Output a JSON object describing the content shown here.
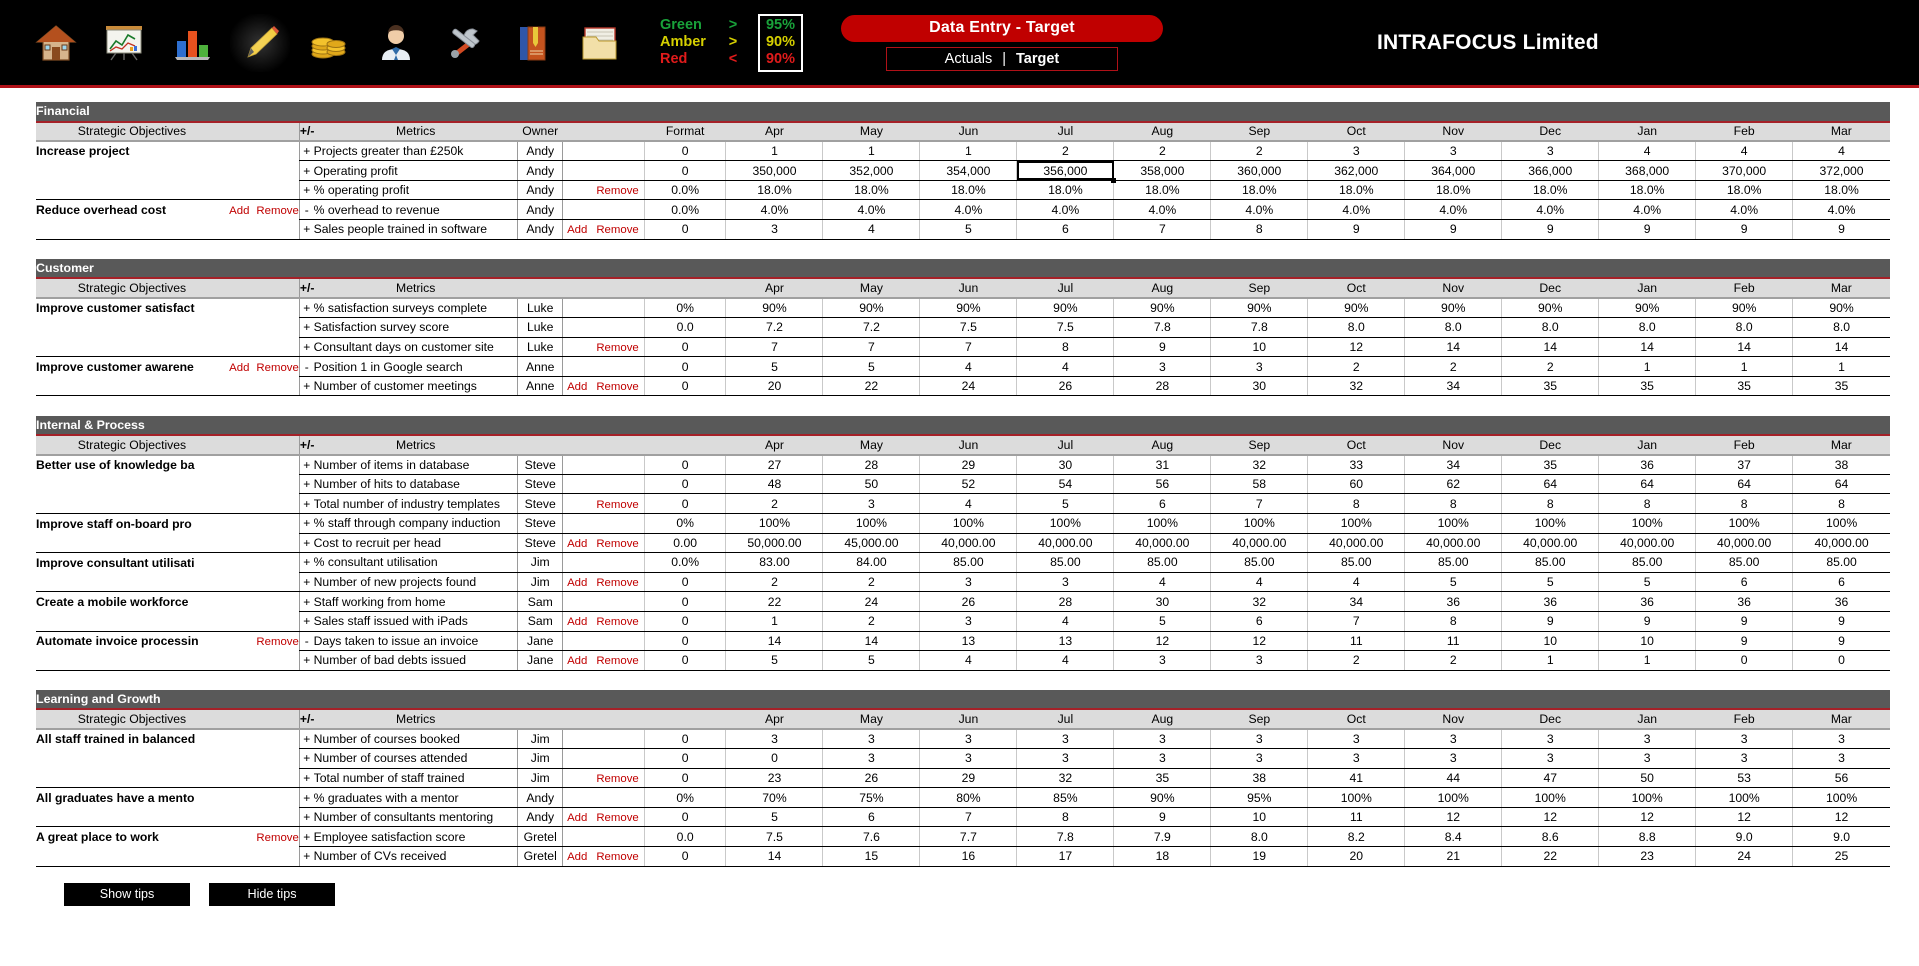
{
  "toolbar": {
    "icons": [
      {
        "name": "home-icon",
        "label": "Home"
      },
      {
        "name": "presentation-chart-icon",
        "label": "Charts"
      },
      {
        "name": "bar-chart-icon",
        "label": "Bar Chart"
      },
      {
        "name": "pencil-edit-icon",
        "label": "Data Entry"
      },
      {
        "name": "money-coins-icon",
        "label": "Financial"
      },
      {
        "name": "person-user-icon",
        "label": "Customer"
      },
      {
        "name": "tools-wrench-icon",
        "label": "Internal & Process"
      },
      {
        "name": "book-icon",
        "label": "Learning and Growth"
      },
      {
        "name": "folder-files-icon",
        "label": "Reports"
      }
    ]
  },
  "rag": {
    "rows": [
      {
        "label": "Green",
        "op": ">",
        "value": "95%"
      },
      {
        "label": "Amber",
        "op": ">",
        "value": "90%"
      },
      {
        "label": "Red",
        "op": "<",
        "value": "90%"
      }
    ],
    "colors": {
      "green": "#19a23a",
      "amber": "#d6d000",
      "red": "#e01b1b"
    }
  },
  "header": {
    "title": "Data Entry  -  Target",
    "tab_actuals": "Actuals",
    "tab_separator": "|",
    "tab_target": "Target",
    "company": "INTRAFOCUS Limited",
    "accent_red": "#c00000"
  },
  "columns": {
    "objectives": "Strategic Objectives",
    "plusminus": "+/-",
    "metrics": "Metrics",
    "owner": "Owner",
    "format": "Format",
    "months": [
      "Apr",
      "May",
      "Jun",
      "Jul",
      "Aug",
      "Sep",
      "Oct",
      "Nov",
      "Dec",
      "Jan",
      "Feb",
      "Mar"
    ]
  },
  "links": {
    "add": "Add",
    "remove": "Remove"
  },
  "selected_cell": {
    "row": "Operating profit",
    "column": "Jul",
    "value": "356,000"
  },
  "sections": [
    {
      "name": "Financial",
      "rows": [
        {
          "objective": "Increase project",
          "obj_links": [],
          "sign": "+",
          "metric": "Projects greater than £250k",
          "owner": "Andy",
          "row_links": [],
          "format": "0",
          "values": [
            "1",
            "1",
            "1",
            "2",
            "2",
            "2",
            "3",
            "3",
            "3",
            "4",
            "4",
            "4"
          ]
        },
        {
          "objective": "",
          "obj_links": [],
          "sign": "+",
          "metric": "Operating profit",
          "owner": "Andy",
          "row_links": [],
          "format": "0",
          "values": [
            "350,000",
            "352,000",
            "354,000",
            "356,000",
            "358,000",
            "360,000",
            "362,000",
            "364,000",
            "366,000",
            "368,000",
            "370,000",
            "372,000"
          ]
        },
        {
          "objective": "",
          "obj_links": [],
          "sign": "+",
          "metric": "% operating profit",
          "owner": "Andy",
          "row_links": [
            "Remove"
          ],
          "format": "0.0%",
          "values": [
            "18.0%",
            "18.0%",
            "18.0%",
            "18.0%",
            "18.0%",
            "18.0%",
            "18.0%",
            "18.0%",
            "18.0%",
            "18.0%",
            "18.0%",
            "18.0%"
          ]
        },
        {
          "objective": "Reduce overhead cost",
          "obj_links": [
            "Add",
            "Remove"
          ],
          "sign": "-",
          "metric": "% overhead to revenue",
          "owner": "Andy",
          "row_links": [],
          "format": "0.0%",
          "values": [
            "4.0%",
            "4.0%",
            "4.0%",
            "4.0%",
            "4.0%",
            "4.0%",
            "4.0%",
            "4.0%",
            "4.0%",
            "4.0%",
            "4.0%",
            "4.0%"
          ]
        },
        {
          "objective": "",
          "obj_links": [],
          "sign": "+",
          "metric": "Sales people trained in software",
          "owner": "Andy",
          "row_links": [
            "Add",
            "Remove"
          ],
          "format": "0",
          "values": [
            "3",
            "4",
            "5",
            "6",
            "7",
            "8",
            "9",
            "9",
            "9",
            "9",
            "9",
            "9"
          ]
        }
      ]
    },
    {
      "name": "Customer",
      "rows": [
        {
          "objective": "Improve customer satisfact",
          "obj_links": [],
          "sign": "+",
          "metric": "% satisfaction surveys complete",
          "owner": "Luke",
          "row_links": [],
          "format": "0%",
          "values": [
            "90%",
            "90%",
            "90%",
            "90%",
            "90%",
            "90%",
            "90%",
            "90%",
            "90%",
            "90%",
            "90%",
            "90%"
          ]
        },
        {
          "objective": "",
          "obj_links": [],
          "sign": "+",
          "metric": "Satisfaction survey score",
          "owner": "Luke",
          "row_links": [],
          "format": "0.0",
          "values": [
            "7.2",
            "7.2",
            "7.5",
            "7.5",
            "7.8",
            "7.8",
            "8.0",
            "8.0",
            "8.0",
            "8.0",
            "8.0",
            "8.0"
          ]
        },
        {
          "objective": "",
          "obj_links": [],
          "sign": "+",
          "metric": "Consultant days on customer site",
          "owner": "Luke",
          "row_links": [
            "Remove"
          ],
          "format": "0",
          "values": [
            "7",
            "7",
            "7",
            "8",
            "9",
            "10",
            "12",
            "14",
            "14",
            "14",
            "14",
            "14"
          ]
        },
        {
          "objective": "Improve customer awarene",
          "obj_links": [
            "Add",
            "Remove"
          ],
          "sign": "-",
          "metric": "Position 1 in Google search",
          "owner": "Anne",
          "row_links": [],
          "format": "0",
          "values": [
            "5",
            "5",
            "4",
            "4",
            "3",
            "3",
            "2",
            "2",
            "2",
            "1",
            "1",
            "1"
          ]
        },
        {
          "objective": "",
          "obj_links": [],
          "sign": "+",
          "metric": "Number of customer meetings",
          "owner": "Anne",
          "row_links": [
            "Add",
            "Remove"
          ],
          "format": "0",
          "values": [
            "20",
            "22",
            "24",
            "26",
            "28",
            "30",
            "32",
            "34",
            "35",
            "35",
            "35",
            "35"
          ]
        }
      ]
    },
    {
      "name": "Internal & Process",
      "rows": [
        {
          "objective": "Better use of knowledge ba",
          "obj_links": [],
          "sign": "+",
          "metric": "Number of items in database",
          "owner": "Steve",
          "row_links": [],
          "format": "0",
          "values": [
            "27",
            "28",
            "29",
            "30",
            "31",
            "32",
            "33",
            "34",
            "35",
            "36",
            "37",
            "38"
          ]
        },
        {
          "objective": "",
          "obj_links": [],
          "sign": "+",
          "metric": "Number of hits to database",
          "owner": "Steve",
          "row_links": [],
          "format": "0",
          "values": [
            "48",
            "50",
            "52",
            "54",
            "56",
            "58",
            "60",
            "62",
            "64",
            "64",
            "64",
            "64"
          ]
        },
        {
          "objective": "",
          "obj_links": [],
          "sign": "+",
          "metric": "Total number of industry templates",
          "owner": "Steve",
          "row_links": [
            "Remove"
          ],
          "format": "0",
          "values": [
            "2",
            "3",
            "4",
            "5",
            "6",
            "7",
            "8",
            "8",
            "8",
            "8",
            "8",
            "8"
          ]
        },
        {
          "objective": "Improve staff on-board pro",
          "obj_links": [],
          "sign": "+",
          "metric": "% staff through company induction",
          "owner": "Steve",
          "row_links": [],
          "format": "0%",
          "values": [
            "100%",
            "100%",
            "100%",
            "100%",
            "100%",
            "100%",
            "100%",
            "100%",
            "100%",
            "100%",
            "100%",
            "100%"
          ]
        },
        {
          "objective": "",
          "obj_links": [],
          "sign": "+",
          "metric": "Cost to recruit per head",
          "owner": "Steve",
          "row_links": [
            "Add",
            "Remove"
          ],
          "format": "0.00",
          "values": [
            "50,000.00",
            "45,000.00",
            "40,000.00",
            "40,000.00",
            "40,000.00",
            "40,000.00",
            "40,000.00",
            "40,000.00",
            "40,000.00",
            "40,000.00",
            "40,000.00",
            "40,000.00"
          ]
        },
        {
          "objective": "Improve consultant utilisati",
          "obj_links": [],
          "sign": "+",
          "metric": "% consultant utilisation",
          "owner": "Jim",
          "row_links": [],
          "format": "0.0%",
          "values": [
            "83.00",
            "84.00",
            "85.00",
            "85.00",
            "85.00",
            "85.00",
            "85.00",
            "85.00",
            "85.00",
            "85.00",
            "85.00",
            "85.00"
          ]
        },
        {
          "objective": "",
          "obj_links": [],
          "sign": "+",
          "metric": "Number of new projects found",
          "owner": "Jim",
          "row_links": [
            "Add",
            "Remove"
          ],
          "format": "0",
          "values": [
            "2",
            "2",
            "3",
            "3",
            "4",
            "4",
            "4",
            "5",
            "5",
            "5",
            "6",
            "6"
          ]
        },
        {
          "objective": "Create a mobile workforce",
          "obj_links": [],
          "sign": "+",
          "metric": "Staff working from home",
          "owner": "Sam",
          "row_links": [],
          "format": "0",
          "values": [
            "22",
            "24",
            "26",
            "28",
            "30",
            "32",
            "34",
            "36",
            "36",
            "36",
            "36",
            "36"
          ]
        },
        {
          "objective": "",
          "obj_links": [],
          "sign": "+",
          "metric": "Sales staff issued with iPads",
          "owner": "Sam",
          "row_links": [
            "Add",
            "Remove"
          ],
          "format": "0",
          "values": [
            "1",
            "2",
            "3",
            "4",
            "5",
            "6",
            "7",
            "8",
            "9",
            "9",
            "9",
            "9"
          ]
        },
        {
          "objective": "Automate invoice processin",
          "obj_links": [
            "Remove"
          ],
          "sign": "-",
          "metric": "Days taken to issue an invoice",
          "owner": "Jane",
          "row_links": [],
          "format": "0",
          "values": [
            "14",
            "14",
            "13",
            "13",
            "12",
            "12",
            "11",
            "11",
            "10",
            "10",
            "9",
            "9"
          ]
        },
        {
          "objective": "",
          "obj_links": [],
          "sign": "+",
          "metric": "Number of bad debts issued",
          "owner": "Jane",
          "row_links": [
            "Add",
            "Remove"
          ],
          "format": "0",
          "values": [
            "5",
            "5",
            "4",
            "4",
            "3",
            "3",
            "2",
            "2",
            "1",
            "1",
            "0",
            "0"
          ]
        }
      ]
    },
    {
      "name": "Learning and Growth",
      "rows": [
        {
          "objective": "All staff trained in balanced",
          "obj_links": [],
          "sign": "+",
          "metric": "Number of courses booked",
          "owner": "Jim",
          "row_links": [],
          "format": "0",
          "values": [
            "3",
            "3",
            "3",
            "3",
            "3",
            "3",
            "3",
            "3",
            "3",
            "3",
            "3",
            "3"
          ]
        },
        {
          "objective": "",
          "obj_links": [],
          "sign": "+",
          "metric": "Number of courses attended",
          "owner": "Jim",
          "row_links": [],
          "format": "0",
          "values": [
            "0",
            "3",
            "3",
            "3",
            "3",
            "3",
            "3",
            "3",
            "3",
            "3",
            "3",
            "3"
          ]
        },
        {
          "objective": "",
          "obj_links": [],
          "sign": "+",
          "metric": "Total number of staff trained",
          "owner": "Jim",
          "row_links": [
            "Remove"
          ],
          "format": "0",
          "values": [
            "23",
            "26",
            "29",
            "32",
            "35",
            "38",
            "41",
            "44",
            "47",
            "50",
            "53",
            "56"
          ]
        },
        {
          "objective": "All graduates have a mento",
          "obj_links": [],
          "sign": "+",
          "metric": "% graduates with a mentor",
          "owner": "Andy",
          "row_links": [],
          "format": "0%",
          "values": [
            "70%",
            "75%",
            "80%",
            "85%",
            "90%",
            "95%",
            "100%",
            "100%",
            "100%",
            "100%",
            "100%",
            "100%"
          ]
        },
        {
          "objective": "",
          "obj_links": [],
          "sign": "+",
          "metric": "Number of consultants mentoring",
          "owner": "Andy",
          "row_links": [
            "Add",
            "Remove"
          ],
          "format": "0",
          "values": [
            "5",
            "6",
            "7",
            "8",
            "9",
            "10",
            "11",
            "12",
            "12",
            "12",
            "12",
            "12"
          ]
        },
        {
          "objective": "A great place to work",
          "obj_links": [
            "Remove"
          ],
          "sign": "+",
          "metric": "Employee satisfaction score",
          "owner": "Gretel",
          "row_links": [],
          "format": "0.0",
          "values": [
            "7.5",
            "7.6",
            "7.7",
            "7.8",
            "7.9",
            "8.0",
            "8.2",
            "8.4",
            "8.6",
            "8.8",
            "9.0",
            "9.0"
          ]
        },
        {
          "objective": "",
          "obj_links": [],
          "sign": "+",
          "metric": "Number of CVs received",
          "owner": "Gretel",
          "row_links": [
            "Add",
            "Remove"
          ],
          "format": "0",
          "values": [
            "14",
            "15",
            "16",
            "17",
            "18",
            "19",
            "20",
            "21",
            "22",
            "23",
            "24",
            "25"
          ]
        }
      ]
    }
  ],
  "buttons": {
    "show_tips": "Show tips",
    "hide_tips": "Hide tips"
  }
}
